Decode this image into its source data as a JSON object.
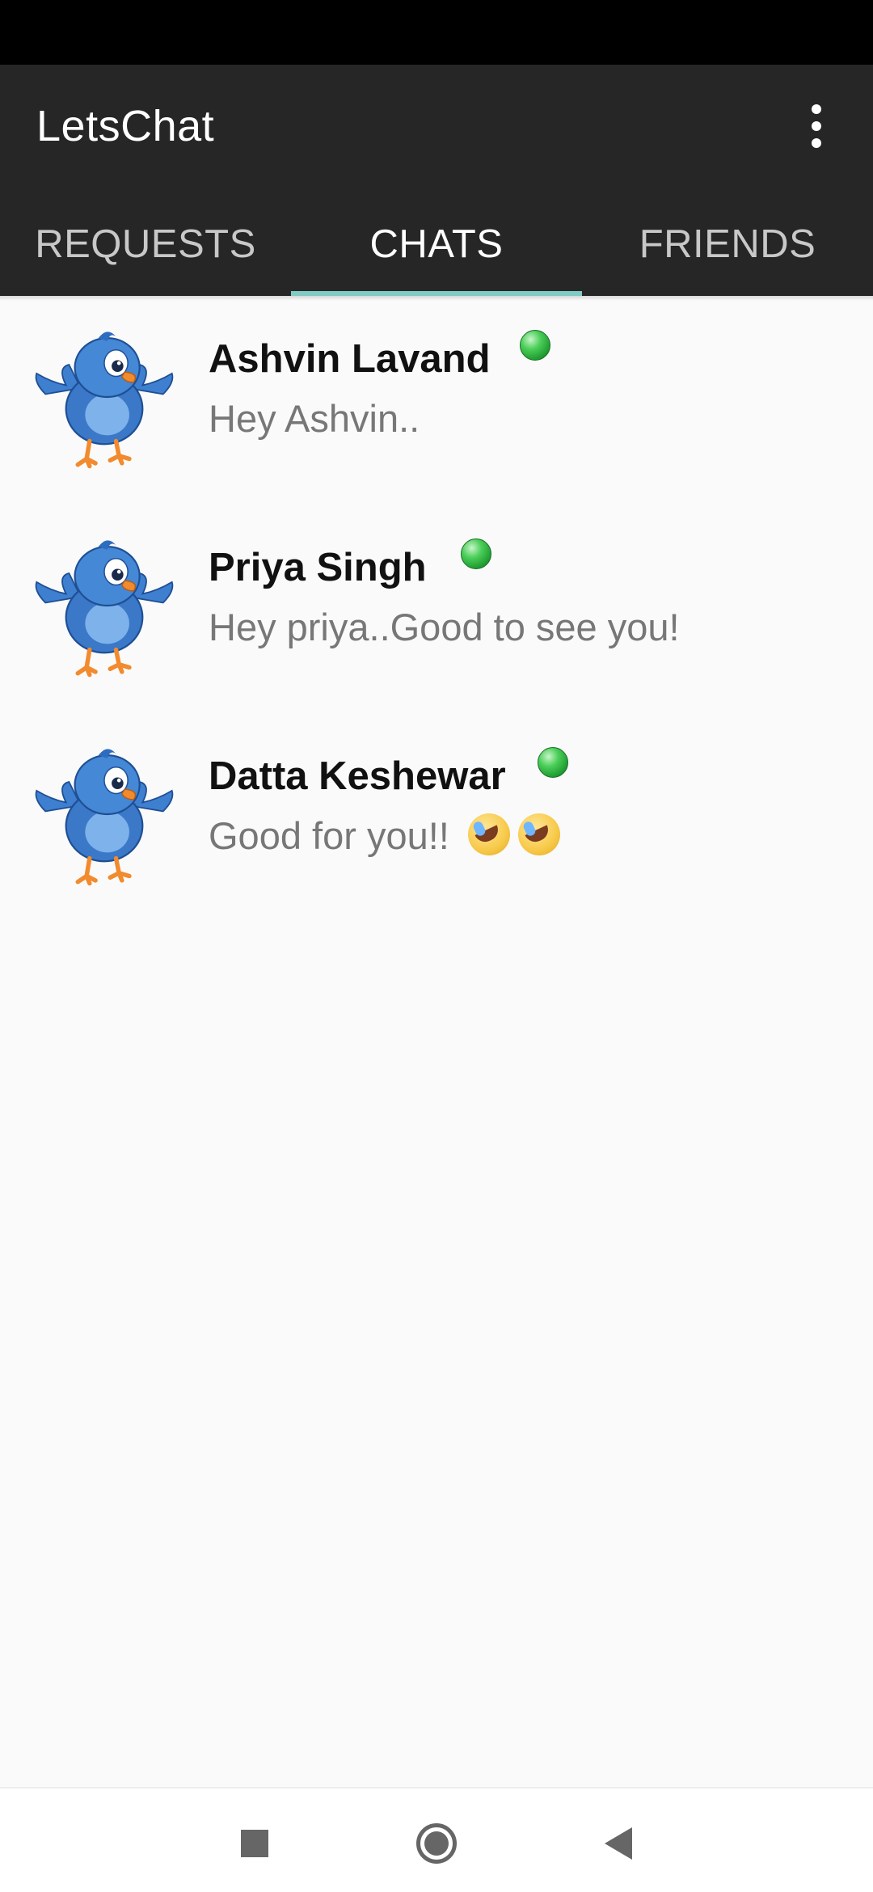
{
  "app": {
    "title": "LetsChat"
  },
  "tabs": [
    {
      "label": "REQUESTS",
      "active": false
    },
    {
      "label": "CHATS",
      "active": true
    },
    {
      "label": "FRIENDS",
      "active": false
    }
  ],
  "colors": {
    "app_bar": "#262626",
    "tab_indicator": "#80cbc4",
    "online": "#2db84a"
  },
  "chats": [
    {
      "name": "Ashvin Lavand",
      "message": "Hey Ashvin..",
      "online": true,
      "emoji_count": 0
    },
    {
      "name": "Priya Singh",
      "message": "Hey priya..Good to see you!",
      "online": true,
      "emoji_count": 0
    },
    {
      "name": "Datta Keshewar",
      "message": "Good for you!!",
      "online": true,
      "emoji_count": 2
    }
  ],
  "icons": {
    "menu": "more-vert-icon",
    "avatar": "bird-avatar-icon",
    "nav": [
      "recents-square-icon",
      "home-circle-icon",
      "back-triangle-icon"
    ]
  }
}
